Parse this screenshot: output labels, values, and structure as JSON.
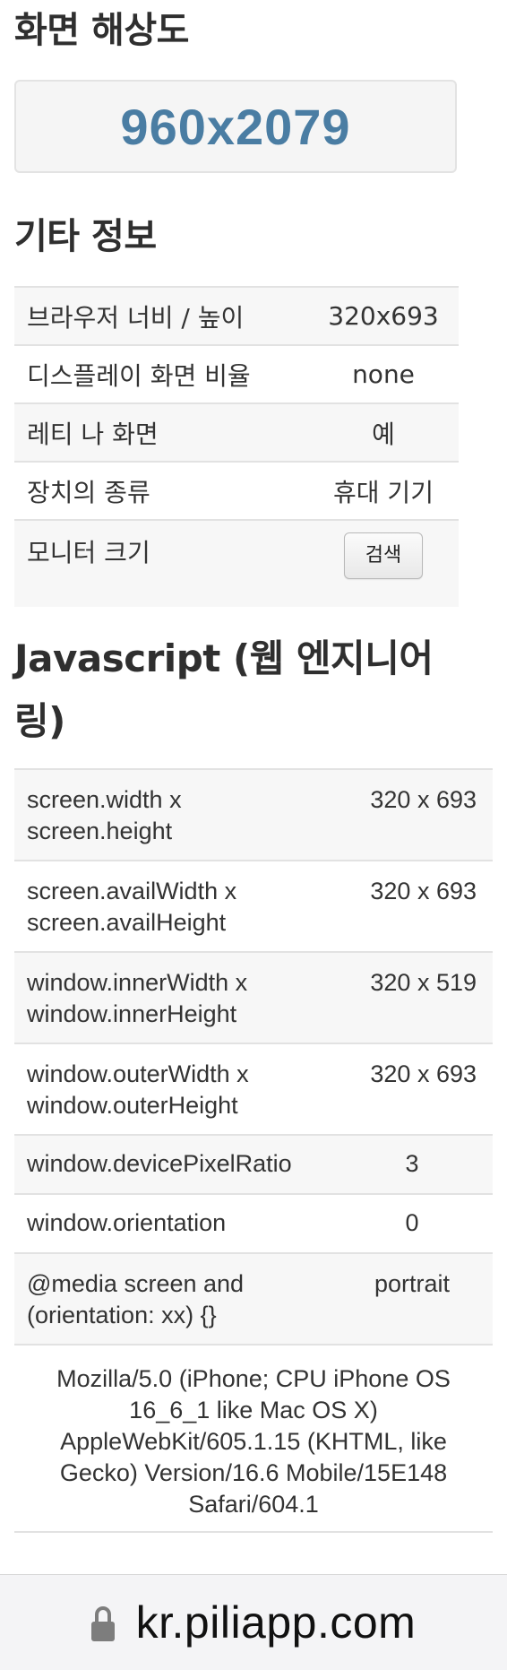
{
  "resolution": {
    "title": "화면 해상도",
    "value": "960x2079"
  },
  "other_info": {
    "title": "기타 정보",
    "rows": [
      {
        "key": "브라우저 너비 / 높이",
        "value": "320x693"
      },
      {
        "key": "디스플레이 화면 비율",
        "value": "none"
      },
      {
        "key": "레티 나 화면",
        "value": "예"
      },
      {
        "key": "장치의 종류",
        "value": "휴대 기기"
      },
      {
        "key": "모니터 크기",
        "button_label": "검색"
      }
    ]
  },
  "javascript": {
    "title": "Javascript (웹 엔지니어링)",
    "rows": [
      {
        "key": "screen.width x screen.height",
        "value": "320 x 693"
      },
      {
        "key": "screen.availWidth x screen.availHeight",
        "value": "320 x 693"
      },
      {
        "key": "window.innerWidth x window.innerHeight",
        "value": "320 x 519"
      },
      {
        "key": "window.outerWidth x window.outerHeight",
        "value": "320 x 693"
      },
      {
        "key": "window.devicePixelRatio",
        "value": "3"
      },
      {
        "key": "window.orientation",
        "value": "0"
      },
      {
        "key": "@media screen and (orientation: xx) {}",
        "value": "portrait"
      }
    ],
    "user_agent": "Mozilla/5.0 (iPhone; CPU iPhone OS 16_6_1 like Mac OS X) AppleWebKit/605.1.15 (KHTML, like Gecko) Version/16.6 Mobile/15E148 Safari/604.1"
  },
  "address_bar": {
    "icon": "lock-icon",
    "url": "kr.piliapp.com"
  },
  "colors": {
    "resolution_value": "#4a7da3",
    "table_stripe": "#f7f7f7",
    "border": "#e2e2e2"
  }
}
